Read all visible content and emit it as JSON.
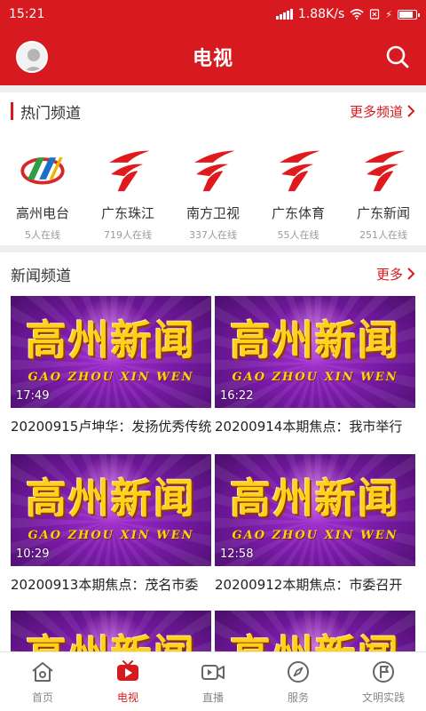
{
  "status_bar": {
    "time": "15:21",
    "network_speed": "1.88K/s",
    "battery_level": 0.9
  },
  "header": {
    "title": "电视"
  },
  "hot_section": {
    "title": "热门频道",
    "more_label": "更多频道"
  },
  "channels": [
    {
      "name": "高州电台",
      "count": "5人在线",
      "logo": "gaozhou-logo"
    },
    {
      "name": "广东珠江",
      "count": "719人在线",
      "logo": "guangdong-logo"
    },
    {
      "name": "南方卫视",
      "count": "337人在线",
      "logo": "guangdong-logo"
    },
    {
      "name": "广东体育",
      "count": "55人在线",
      "logo": "guangdong-logo"
    },
    {
      "name": "广东新闻",
      "count": "251人在线",
      "logo": "guangdong-logo"
    }
  ],
  "news_section": {
    "title": "新闻频道",
    "more_label": "更多"
  },
  "thumb": {
    "title": "高州新闻",
    "subtitle": "GAO ZHOU XIN WEN"
  },
  "videos": [
    {
      "duration": "17:49",
      "title": "20200915卢坤华：发扬优秀传统"
    },
    {
      "duration": "16:22",
      "title": "20200914本期焦点：我市举行"
    },
    {
      "duration": "10:29",
      "title": "20200913本期焦点：茂名市委"
    },
    {
      "duration": "12:58",
      "title": "20200912本期焦点：市委召开"
    },
    {
      "duration": "",
      "title": ""
    },
    {
      "duration": "",
      "title": ""
    }
  ],
  "bottom_nav": [
    {
      "label": "首页",
      "icon": "home-icon",
      "active": false
    },
    {
      "label": "电视",
      "icon": "tv-play-icon",
      "active": true
    },
    {
      "label": "直播",
      "icon": "video-camera-icon",
      "active": false
    },
    {
      "label": "服务",
      "icon": "compass-icon",
      "active": false
    },
    {
      "label": "文明实践",
      "icon": "flag-circle-icon",
      "active": false
    }
  ],
  "colors": {
    "brand_red": "#d71a1f",
    "separator": "#eeeeee",
    "muted": "#9a9a9a",
    "thumb_gold": "#ffd11a"
  }
}
